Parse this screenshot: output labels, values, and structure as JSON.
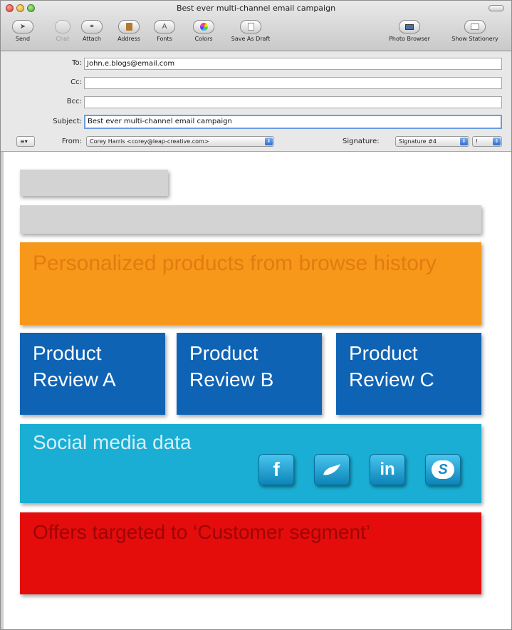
{
  "window": {
    "title": "Best ever multi-channel email campaign"
  },
  "toolbar": {
    "send": "Send",
    "chat": "Chat",
    "attach": "Attach",
    "address": "Address",
    "fonts": "Fonts",
    "colors": "Colors",
    "save_as_draft": "Save As Draft",
    "photo_browser": "Photo Browser",
    "show_stationery": "Show Stationery"
  },
  "header": {
    "to_label": "To:",
    "to_value": "John.e.blogs@email.com",
    "cc_label": "Cc:",
    "cc_value": "",
    "bcc_label": "Bcc:",
    "bcc_value": "",
    "subject_label": "Subject:",
    "subject_value": "Best ever multi-channel email campaign",
    "from_label": "From:",
    "from_value": "Corey Harris <corey@leap-creative.com>",
    "signature_label": "Signature:",
    "signature_value": "Signature #4",
    "priority_value": "!"
  },
  "content": {
    "personalized": "Personalized products from browse history",
    "product_a": "Product Review A",
    "product_b": "Product Review B",
    "product_c": "Product Review C",
    "social": "Social media data",
    "offers": "Offers targeted to ‘Customer segment’",
    "social_icons": [
      "facebook-icon",
      "twitter-icon",
      "linkedin-icon",
      "skype-icon"
    ]
  },
  "colors": {
    "orange": "#f7981a",
    "blue": "#0e63b5",
    "teal": "#1aaed4",
    "red": "#e50c0c",
    "gray": "#d3d3d3"
  }
}
